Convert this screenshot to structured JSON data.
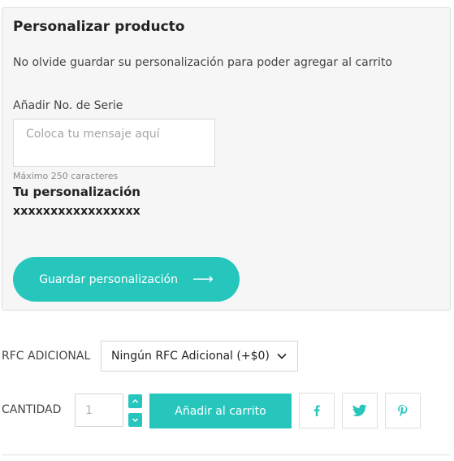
{
  "customize": {
    "title": "Personalizar producto",
    "note": "No olvide guardar su personalización para poder agregar al carrito",
    "field_label": "Añadir No. de Serie",
    "placeholder": "Coloca tu mensaje aquí",
    "max_chars": "Máximo 250 caracteres",
    "custom_title": "Tu personalización",
    "custom_value": "xxxxxxxxxxxxxxxxx",
    "save_label": "Guardar personalización",
    "arrow_glyph": "⟶"
  },
  "rfc": {
    "label": "RFC ADICIONAL",
    "selected": "Ningún RFC Adicional (+$0)"
  },
  "quantity": {
    "label": "CANTIDAD",
    "value": "1"
  },
  "add_to_cart_label": "Añadir al carrito",
  "share": {
    "icons": [
      "facebook-icon",
      "twitter-icon",
      "pinterest-icon"
    ]
  },
  "colors": {
    "accent": "#26c6bd",
    "panel_bg": "#f6f6f6"
  }
}
